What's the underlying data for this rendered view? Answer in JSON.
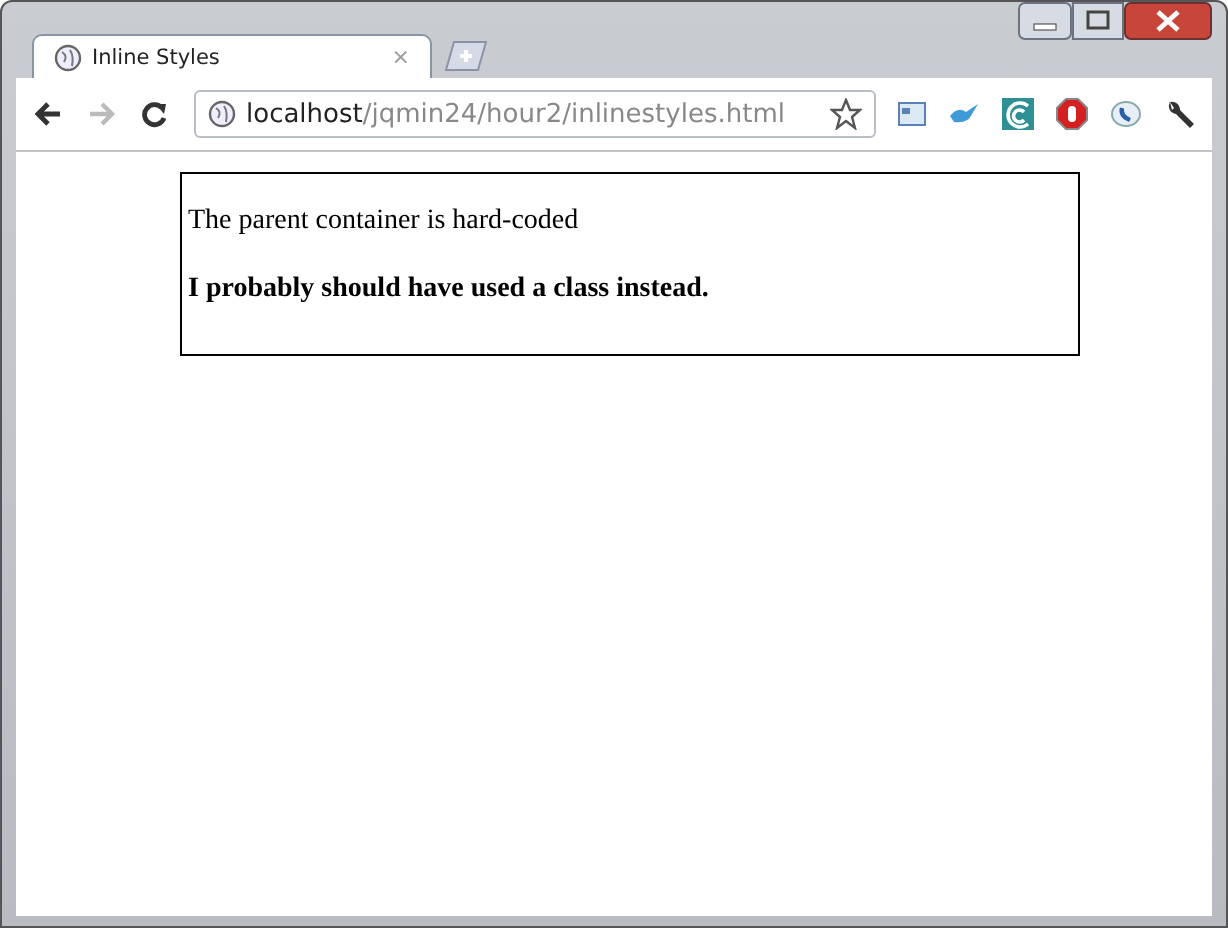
{
  "tabs": [
    {
      "title": "Inline Styles",
      "close": "×",
      "selected": true
    }
  ],
  "address": {
    "host": "localhost",
    "path": "/jqmin24/hour2/inlinestyles.html"
  },
  "content": {
    "lines": [
      {
        "text": "The parent container is hard-coded",
        "kind": "normal"
      },
      {
        "text": "I probably should have used a class instead.",
        "kind": "bold"
      }
    ]
  }
}
